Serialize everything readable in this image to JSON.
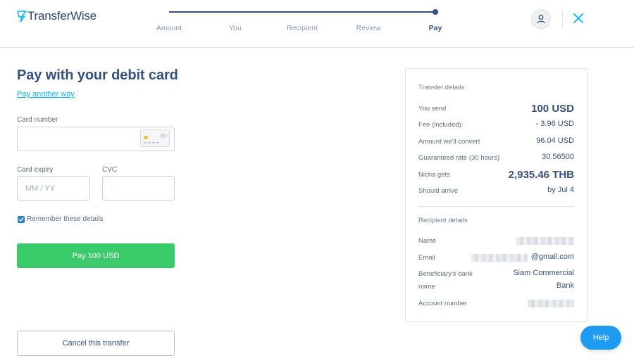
{
  "header": {
    "brand": "TransferWise",
    "steps": [
      {
        "label": "Amount"
      },
      {
        "label": "You"
      },
      {
        "label": "Recipient"
      },
      {
        "label": "Review"
      },
      {
        "label": "Pay"
      }
    ],
    "active_step": "Pay"
  },
  "form": {
    "title": "Pay with your debit card",
    "pay_another_way": "Pay another way",
    "card_number_label": "Card number",
    "card_number_value": "",
    "card_expiry_label": "Card expiry",
    "card_expiry_placeholder": "MM / YY",
    "cvc_label": "CVC",
    "cvc_value": "",
    "remember_label": "Remember these details",
    "remember_checked": true,
    "pay_button": "Pay 100 USD",
    "cancel_button": "Cancel this transfer"
  },
  "transfer_details": {
    "heading": "Transfer details",
    "rows": [
      {
        "label": "You send",
        "value": "100 USD"
      },
      {
        "label": "Fee (included):",
        "value": "- 3.96 USD"
      },
      {
        "label": "Amount we'll convert",
        "value": "96.04 USD"
      },
      {
        "label": "Guaranteed rate (30 hours)",
        "value": "30.56500"
      },
      {
        "label": "Nicha gets",
        "value": "2,935.46 THB"
      },
      {
        "label": "Should arrive",
        "value": "by Jul 4"
      }
    ]
  },
  "recipient_details": {
    "heading": "Recipient details",
    "name_label": "Name",
    "email_label": "Email",
    "email_suffix": "@gmail.com",
    "bank_label_line1": "Beneficiary's bank",
    "bank_label_line2": "name",
    "bank_value_line1": "Siam Commercial",
    "bank_value_line2": "Bank",
    "account_label": "Account number"
  },
  "help": {
    "label": "Help"
  },
  "colors": {
    "brand_navy": "#37517e",
    "accent_blue": "#00b9ff",
    "pay_green": "#3ccb6b",
    "help_blue": "#1d9bf0"
  }
}
